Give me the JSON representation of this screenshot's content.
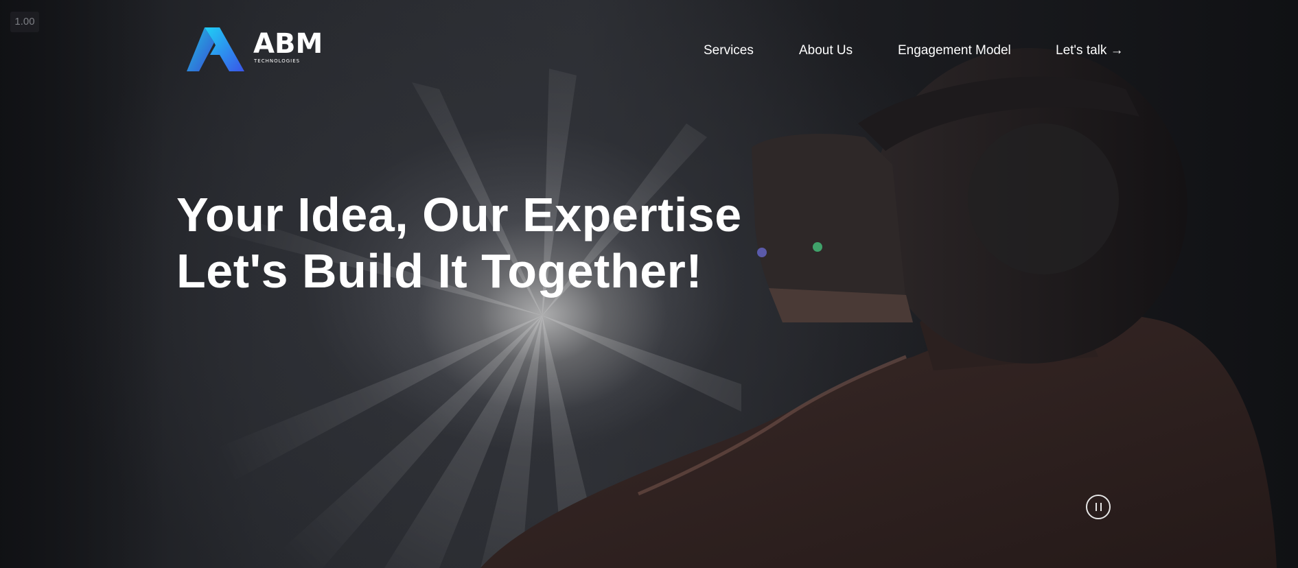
{
  "zoom_level": "1.00",
  "logo": {
    "name": "ABM",
    "tagline": "TECHNOLOGIES",
    "icon": "abm-logo-mark-icon",
    "gradient": [
      "#1fd0f5",
      "#3a55e8"
    ]
  },
  "nav": {
    "items": [
      {
        "label": "Services"
      },
      {
        "label": "About Us"
      },
      {
        "label": "Engagement Model"
      },
      {
        "label": "Let's talk →"
      }
    ]
  },
  "hero": {
    "headline_line1": "Your Idea, Our Expertise",
    "headline_line2": "Let's Build It Together!",
    "video_control": {
      "icon": "pause-icon",
      "state": "playing"
    }
  },
  "colors": {
    "text": "#ffffff",
    "background": "#16171b"
  }
}
